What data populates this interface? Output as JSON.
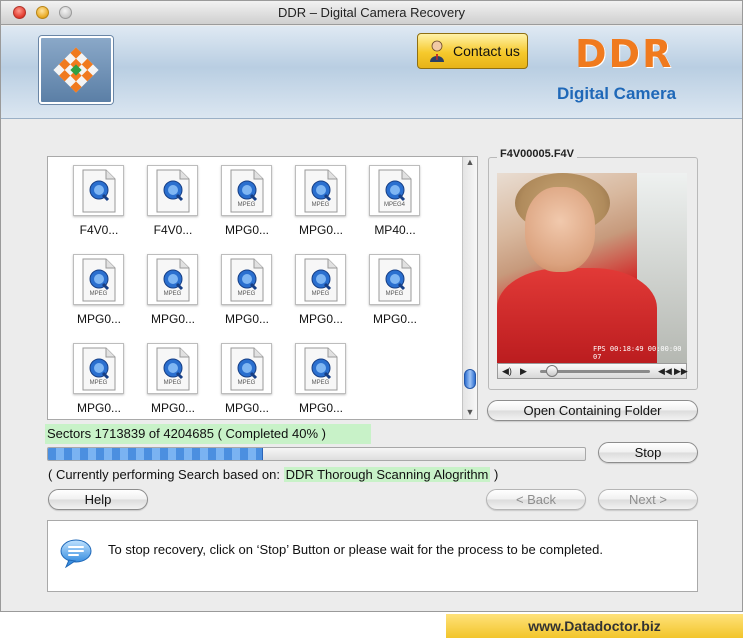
{
  "window": {
    "title": "DDR – Digital Camera Recovery"
  },
  "banner": {
    "contact_label": "Contact us",
    "brand": "DDR",
    "brand_sub": "Digital Camera"
  },
  "files": [
    {
      "name": "F4V0...",
      "type": ""
    },
    {
      "name": "F4V0...",
      "type": ""
    },
    {
      "name": "MPG0...",
      "type": "MPEG"
    },
    {
      "name": "MPG0...",
      "type": "MPEG"
    },
    {
      "name": "MP40...",
      "type": "MPEG4"
    },
    {
      "name": "MPG0...",
      "type": "MPEG"
    },
    {
      "name": "MPG0...",
      "type": "MPEG"
    },
    {
      "name": "MPG0...",
      "type": "MPEG"
    },
    {
      "name": "MPG0...",
      "type": "MPEG"
    },
    {
      "name": "MPG0...",
      "type": "MPEG"
    },
    {
      "name": "MPG0...",
      "type": "MPEG"
    },
    {
      "name": "MPG0...",
      "type": "MPEG"
    },
    {
      "name": "MPG0...",
      "type": "MPEG"
    },
    {
      "name": "MPG0...",
      "type": "MPEG"
    }
  ],
  "preview": {
    "filename": "F4V00005.F4V",
    "video_stamp": "FPS 00:18:49 00:00:00 07"
  },
  "buttons": {
    "open_folder": "Open Containing Folder",
    "stop": "Stop",
    "help": "Help",
    "back": "< Back",
    "next": "Next >"
  },
  "progress": {
    "sectors_text": "Sectors 1713839 of 4204685   ( Completed 40% )",
    "fraction": 0.4
  },
  "scan": {
    "prefix": "( Currently performing Search based on: ",
    "algorithm": "DDR Thorough Scanning Alogrithm",
    "suffix": " )"
  },
  "info": {
    "message": "To stop recovery, click on ‘Stop’ Button or please wait for the process to be completed."
  },
  "footer": {
    "url": "www.Datadoctor.biz"
  },
  "colors": {
    "accent_orange": "#f07a1e",
    "accent_blue": "#1f68b8",
    "highlight_green": "#c8f2c8",
    "footer_yellow": "#f2c52b"
  }
}
